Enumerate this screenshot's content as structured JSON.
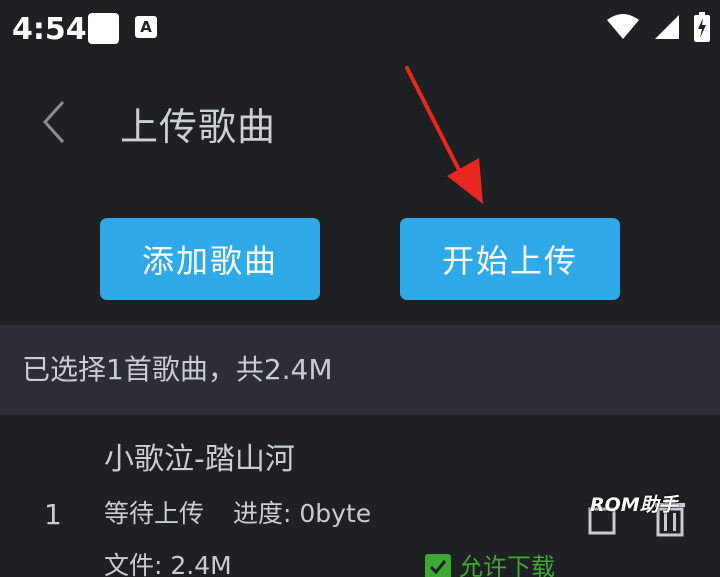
{
  "status_bar": {
    "time": "4:54",
    "notification_letter": "A",
    "icons": [
      "square-notification-icon",
      "a-notification-icon",
      "wifi-icon",
      "signal-icon",
      "battery-charging-icon"
    ]
  },
  "header": {
    "title": "上传歌曲",
    "back_icon": "chevron-left-icon"
  },
  "buttons": {
    "add_label": "添加歌曲",
    "upload_label": "开始上传"
  },
  "summary": {
    "text": "已选择1首歌曲，共2.4M"
  },
  "songs": [
    {
      "index": "1",
      "name": "小歌泣-踏山河",
      "status": "等待上传",
      "progress": "进度: 0byte",
      "size": "文件: 2.4M",
      "allow_download_label": "允许下载",
      "allow_download_checked": true
    }
  ],
  "watermark": "ROM助手",
  "colors": {
    "background": "#1f2023",
    "accent": "#2fa9e8",
    "summary_bg": "#2d2d38",
    "text": "#c8ccd3",
    "checkbox_green": "#3fa833",
    "annotation_red": "#e8271f"
  }
}
